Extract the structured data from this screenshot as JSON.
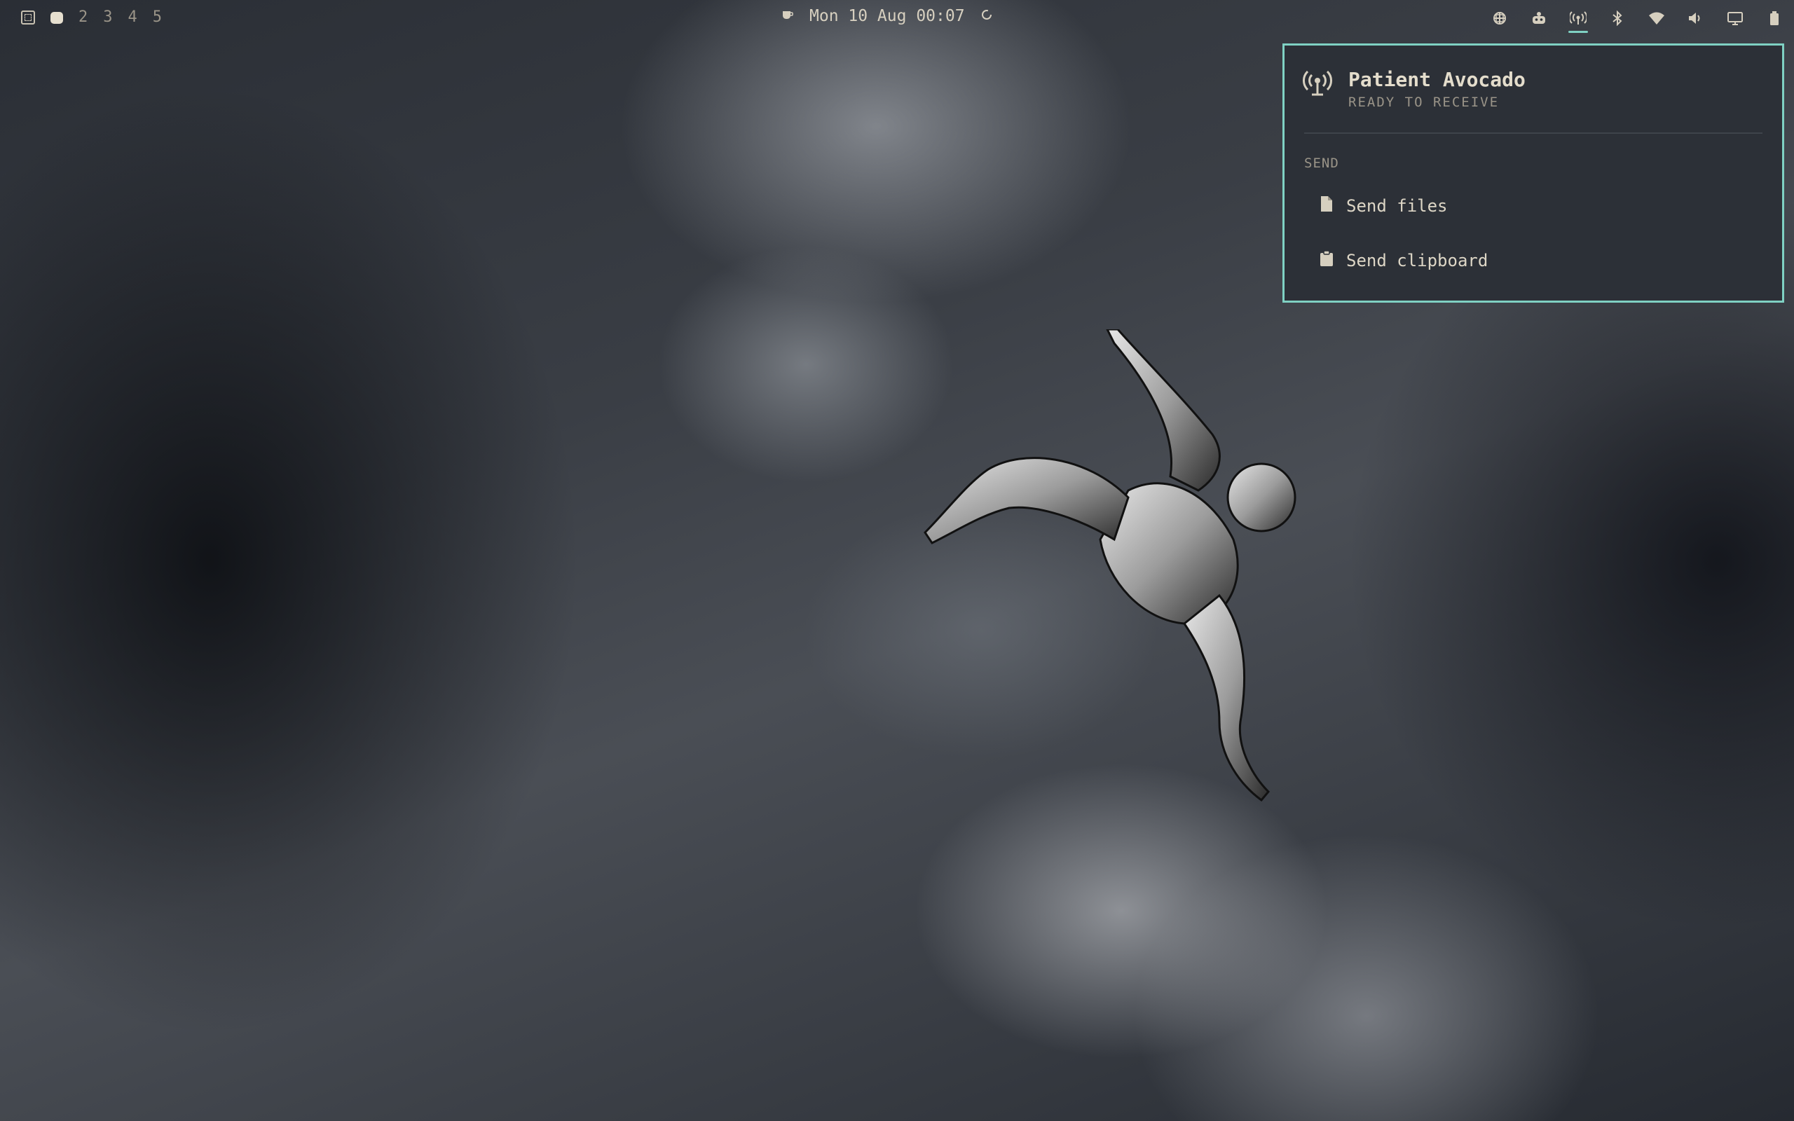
{
  "topbar": {
    "workspaces": [
      "2",
      "3",
      "4",
      "5"
    ],
    "clock": "Mon 10 Aug 00:07",
    "tray_icons": [
      "network-grid-icon",
      "robot-icon",
      "broadcast-icon",
      "bluetooth-icon",
      "wifi-icon",
      "volume-icon",
      "display-icon",
      "battery-icon"
    ]
  },
  "popup": {
    "device_name": "Patient Avocado",
    "status": "READY TO RECEIVE",
    "section_label": "SEND",
    "items": [
      {
        "label": "Send files",
        "icon": "file-icon"
      },
      {
        "label": "Send clipboard",
        "icon": "clipboard-icon"
      }
    ]
  },
  "colors": {
    "accent": "#7fd1c3",
    "panel_bg": "#2c3037",
    "text": "#d6cfbf",
    "muted": "#9a9488"
  }
}
